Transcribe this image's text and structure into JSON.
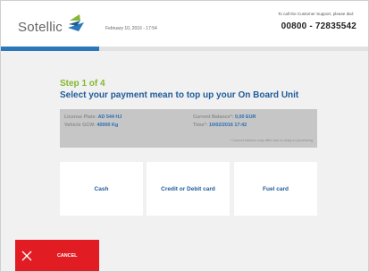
{
  "header": {
    "logo_text": "Sotellic",
    "datetime": "February 10, 2016 - 17:54",
    "support_label": "To call the Customer Support, please dial:",
    "support_number": "00800 - 72835542"
  },
  "step": {
    "label": "Step 1 of 4",
    "title": "Select your payment mean to top up your On Board Unit"
  },
  "info": {
    "license_label": "License Plate: ",
    "license_value": "AD 544 HJ",
    "gcw_label": "Vehicle GCW: ",
    "gcw_value": "40000 Kg",
    "balance_label": "Current Balance*: ",
    "balance_value": "0,00 EUR",
    "time_label": "Time*: ",
    "time_value": "10/02/2016 17:42",
    "note": "* Current balance may differ due to delay in processing"
  },
  "options": [
    {
      "label": "Cash"
    },
    {
      "label": "Credit or Debit card"
    },
    {
      "label": "Fuel card"
    }
  ],
  "footer": {
    "cancel_label": "CANCEL"
  },
  "colors": {
    "accent_blue": "#2a78b8",
    "step_green": "#86b831",
    "title_blue": "#1f5c9b",
    "cancel_red": "#e11c23"
  }
}
